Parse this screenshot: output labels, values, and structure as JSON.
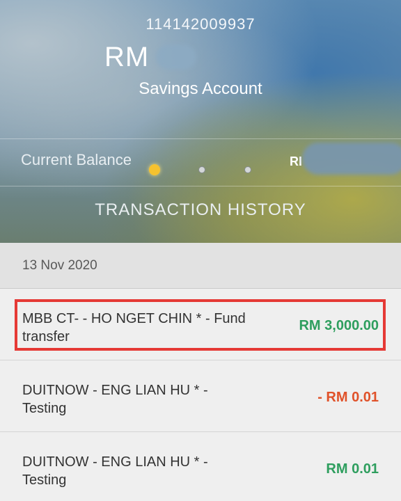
{
  "account": {
    "number": "114142009937",
    "currency": "RM",
    "type": "Savings Account"
  },
  "summary": {
    "current_balance_label": "Current Balance",
    "right_currency_partial": "RI",
    "carousel": {
      "pages": 3,
      "active": 1
    }
  },
  "nav": {
    "transaction_history_label": "TRANSACTION HISTORY"
  },
  "transactions": {
    "date": "13 Nov 2020",
    "items": [
      {
        "description": "MBB CT- - HO NGET CHIN * - Fund transfer",
        "amount": "RM 3,000.00",
        "direction": "credit",
        "highlighted": true
      },
      {
        "description": "DUITNOW - ENG LIAN HU * - Testing",
        "amount": "- RM 0.01",
        "direction": "debit",
        "highlighted": false
      },
      {
        "description": "DUITNOW - ENG LIAN HU * - Testing",
        "amount": "RM 0.01",
        "direction": "credit",
        "highlighted": false
      }
    ]
  },
  "colors": {
    "credit": "#2e9e5e",
    "debit": "#e0522a",
    "highlight_border": "#e53935",
    "carousel_active": "#f6c22f"
  },
  "icons": {
    "active_dot": "carousel-dot-active-icon",
    "inactive_dot": "carousel-dot-icon"
  }
}
